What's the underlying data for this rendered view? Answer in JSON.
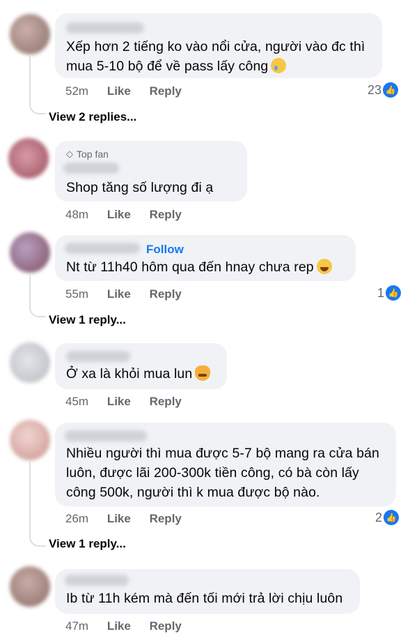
{
  "comments": [
    {
      "text_lines": [
        "Xếp hơn 2 tiếng ko vào nổi cửa, người vào đc thì",
        "mua 5-10 bộ để về pass lấy công"
      ],
      "emoji": "crying-face",
      "time": "52m",
      "like": "Like",
      "reply": "Reply",
      "reactions": "23",
      "view_replies": "View 2 replies..."
    },
    {
      "badge": "Top fan",
      "text_lines": [
        "Shop tăng số lượng đi ạ"
      ],
      "time": "48m",
      "like": "Like",
      "reply": "Reply"
    },
    {
      "follow": "Follow",
      "text_lines": [
        "Nt từ 11h40 hôm qua đến hnay chưa rep"
      ],
      "emoji": "laughing-tears-face",
      "time": "55m",
      "like": "Like",
      "reply": "Reply",
      "reactions": "1",
      "view_replies": "View 1 reply..."
    },
    {
      "text_lines": [
        "Ở xa là khỏi mua lun"
      ],
      "emoji": "pouting-cat-face",
      "time": "45m",
      "like": "Like",
      "reply": "Reply"
    },
    {
      "text_lines": [
        "Nhiều người thì mua được 5-7 bộ mang ra cửa bán",
        "luôn, được lãi 200-300k tiền công, có bà còn lấy",
        "công 500k, người thì k mua được bộ nào."
      ],
      "time": "26m",
      "like": "Like",
      "reply": "Reply",
      "reactions": "2",
      "view_replies": "View 1 reply..."
    },
    {
      "text_lines": [
        "Ib từ 11h kém mà đến tối mới trả lời chịu luôn"
      ],
      "time": "47m",
      "like": "Like",
      "reply": "Reply"
    }
  ],
  "colors": {
    "bubble": "#f0f2f5",
    "meta": "#65676b",
    "link": "#1877f2",
    "like_badge": "#1877f2"
  }
}
